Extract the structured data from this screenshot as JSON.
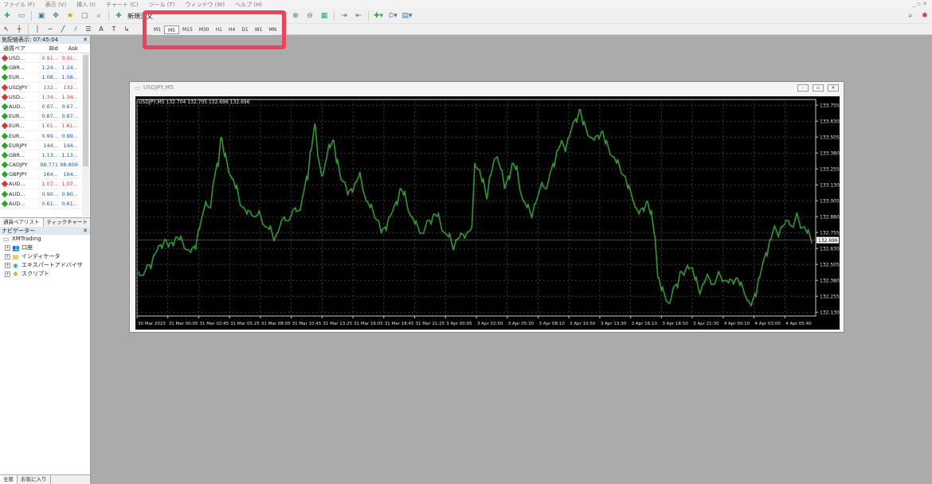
{
  "menu": {
    "items": [
      "ファイル (F)",
      "表示 (V)",
      "挿入 (I)",
      "チャート (C)",
      "ツール (T)",
      "ウィンドウ (W)",
      "ヘルプ (H)"
    ]
  },
  "toolbar": {
    "new_order_label": "新規注文"
  },
  "timeframes": {
    "items": [
      "M1",
      "M5",
      "M15",
      "M30",
      "H1",
      "H4",
      "D1",
      "W1",
      "MN"
    ],
    "active": "M5"
  },
  "market_watch": {
    "title": "気配値表示: 07:45:04",
    "columns": [
      "通貨ペア",
      "Bid",
      "Ask"
    ],
    "rows": [
      {
        "symbol": "USD...",
        "bid": "0.91...",
        "ask": "0.91...",
        "color": "red"
      },
      {
        "symbol": "GBR...",
        "bid": "1.24...",
        "ask": "1.24...",
        "color": "blue"
      },
      {
        "symbol": "EUR...",
        "bid": "1.08...",
        "ask": "1.08...",
        "color": "blue"
      },
      {
        "symbol": "USDJPY",
        "bid": "132...",
        "ask": "132...",
        "color": "red"
      },
      {
        "symbol": "USD...",
        "bid": "1.34...",
        "ask": "1.34...",
        "color": "red"
      },
      {
        "symbol": "AUD...",
        "bid": "0.67...",
        "ask": "0.67...",
        "color": "blue"
      },
      {
        "symbol": "EUR...",
        "bid": "0.87...",
        "ask": "0.87...",
        "color": "blue"
      },
      {
        "symbol": "EUR...",
        "bid": "1.61...",
        "ask": "1.61...",
        "color": "red"
      },
      {
        "symbol": "EUR...",
        "bid": "0.99...",
        "ask": "0.99...",
        "color": "blue"
      },
      {
        "symbol": "EURJPY",
        "bid": "144...",
        "ask": "144...",
        "color": "blue"
      },
      {
        "symbol": "GBR...",
        "bid": "1.13...",
        "ask": "1.13...",
        "color": "blue"
      },
      {
        "symbol": "CADJPY",
        "bid": "98.771",
        "ask": "98.806",
        "color": "blue"
      },
      {
        "symbol": "GBPJPY",
        "bid": "164...",
        "ask": "164...",
        "color": "blue"
      },
      {
        "symbol": "AUD...",
        "bid": "1.07...",
        "ask": "1.07...",
        "color": "red"
      },
      {
        "symbol": "AUD...",
        "bid": "0.90...",
        "ask": "0.90...",
        "color": "blue"
      },
      {
        "symbol": "AUD...",
        "bid": "0.61...",
        "ask": "0.61...",
        "color": "blue"
      }
    ],
    "tabs": [
      "通貨ペアリスト",
      "ティックチャート"
    ]
  },
  "navigator": {
    "title": "ナビゲーター",
    "root": "XMTrading",
    "nodes": [
      "口座",
      "インディケータ",
      "エキスパートアドバイザ",
      "スクリプト"
    ],
    "tabs": [
      "全般",
      "お気に入り"
    ]
  },
  "chart_window": {
    "title": "USDJPY,M5"
  },
  "chart_data": {
    "type": "line",
    "symbol_label": "USDJPY,M5  132.704 132.705 132.696 132.696",
    "current_price_label": "132.696",
    "series_color": "#2e9a2e",
    "grid": true,
    "ylim": [
      132.1,
      133.8
    ],
    "yticks": [
      "133.755",
      "133.630",
      "133.505",
      "133.380",
      "133.255",
      "133.130",
      "133.005",
      "132.880",
      "132.755",
      "132.630",
      "132.505",
      "132.380",
      "132.255",
      "132.130"
    ],
    "xticks": [
      "30 Mar 2023",
      "31 Mar 00:05",
      "31 Mar 02:45",
      "31 Mar 05:25",
      "31 Mar 08:05",
      "31 Mar 10:45",
      "31 Mar 13:25",
      "31 Mar 16:05",
      "31 Mar 18:45",
      "31 Mar 21:25",
      "3 Apr 00:05",
      "3 Apr 02:50",
      "3 Apr 05:30",
      "3 Apr 08:10",
      "3 Apr 10:50",
      "3 Apr 13:30",
      "3 Apr 16:10",
      "3 Apr 18:50",
      "3 Apr 21:30",
      "4 Apr 00:10",
      "4 Apr 03:00",
      "4 Apr 05:40"
    ],
    "values": [
      132.45,
      132.42,
      132.47,
      132.5,
      132.58,
      132.62,
      132.66,
      132.7,
      132.64,
      132.68,
      132.72,
      132.7,
      132.66,
      132.62,
      132.6,
      132.65,
      132.78,
      132.88,
      133.0,
      132.95,
      133.15,
      133.3,
      133.5,
      133.35,
      133.25,
      133.18,
      133.1,
      133.0,
      132.95,
      132.9,
      132.92,
      132.88,
      132.9,
      132.85,
      132.8,
      132.78,
      132.72,
      132.75,
      132.82,
      132.88,
      132.85,
      132.9,
      132.95,
      132.93,
      133.05,
      133.2,
      133.4,
      133.58,
      133.35,
      133.2,
      133.3,
      133.45,
      133.48,
      133.3,
      133.2,
      133.15,
      133.05,
      133.1,
      133.15,
      133.2,
      133.1,
      133.0,
      132.95,
      132.9,
      132.85,
      132.75,
      132.8,
      132.88,
      132.92,
      133.0,
      133.1,
      133.05,
      132.95,
      132.88,
      132.82,
      132.78,
      132.75,
      132.82,
      132.85,
      132.9,
      132.88,
      132.8,
      132.75,
      132.72,
      132.65,
      132.7,
      132.72,
      132.74,
      132.76,
      132.78,
      133.3,
      133.25,
      133.15,
      133.05,
      133.2,
      133.3,
      133.35,
      133.25,
      133.1,
      133.2,
      133.3,
      133.25,
      133.1,
      133.0,
      132.95,
      132.9,
      132.98,
      133.05,
      133.15,
      133.1,
      133.2,
      133.3,
      133.4,
      133.45,
      133.42,
      133.5,
      133.58,
      133.65,
      133.72,
      133.6,
      133.55,
      133.5,
      133.48,
      133.52,
      133.55,
      133.45,
      133.4,
      133.35,
      133.3,
      133.25,
      133.2,
      133.1,
      133.05,
      132.95,
      132.9,
      132.95,
      133.0,
      132.9,
      132.75,
      132.4,
      132.3,
      132.25,
      132.2,
      132.3,
      132.35,
      132.45,
      132.42,
      132.5,
      132.48,
      132.38,
      132.3,
      132.35,
      132.4,
      132.38,
      132.35,
      132.42,
      132.4,
      132.38,
      132.36,
      132.38,
      132.4,
      132.34,
      132.3,
      132.22,
      132.18,
      132.28,
      132.4,
      132.5,
      132.6,
      132.7,
      132.78,
      132.75,
      132.8,
      132.82,
      132.85,
      132.8,
      132.88,
      132.82,
      132.8,
      132.75,
      132.7
    ]
  }
}
